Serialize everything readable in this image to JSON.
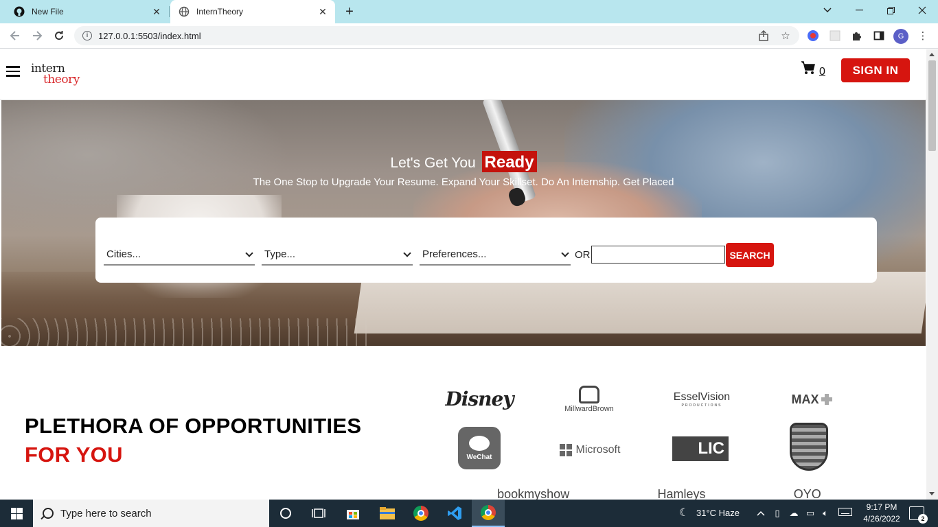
{
  "browser": {
    "tabs": [
      {
        "title": "New File",
        "icon": "github-icon"
      },
      {
        "title": "InternTheory",
        "icon": "globe-icon"
      }
    ],
    "url": "127.0.0.1:5503/index.html",
    "profile_initial": "G"
  },
  "site": {
    "logo_line1": "intern",
    "logo_line2": "theory",
    "cart_count": "0",
    "signin_label": "SIGN IN",
    "hero": {
      "title_prefix": "Let's Get You",
      "title_highlight": "Ready",
      "subtitle": "The One Stop to Upgrade Your Resume. Expand Your Skillset. Do An Internship. Get Placed"
    },
    "search": {
      "cities_value": "Cities...",
      "type_value": "Type...",
      "preferences_value": "Preferences...",
      "or_label": "OR",
      "query_value": "",
      "button_label": "SEARCH"
    },
    "opportunities": {
      "title_line1": "PLETHORA OF OPPORTUNITIES",
      "title_line2": "FOR YOU"
    },
    "partner_logos": {
      "disney": "Disney",
      "millward": "MillwardBrown",
      "essel": "EsselVision",
      "essel_sub": "PRODUCTIONS",
      "max": "MAX",
      "wechat": "WeChat",
      "microsoft": "Microsoft",
      "lic": "LIC",
      "partial": [
        "bookmyshow",
        "Hamleys",
        "OYO"
      ]
    }
  },
  "taskbar": {
    "search_placeholder": "Type here to search",
    "weather": "31°C  Haze",
    "time": "9:17 PM",
    "date": "4/26/2022",
    "notifications": "2"
  },
  "colors": {
    "brand_red": "#d6150f",
    "tabbar": "#b8e6ee",
    "taskbar": "#1c2c38"
  }
}
